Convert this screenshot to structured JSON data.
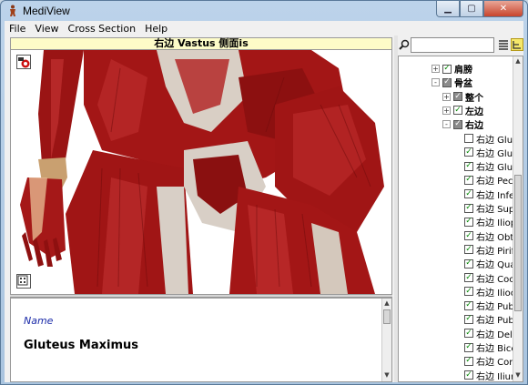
{
  "window": {
    "title": "MediView",
    "app_icon": "anatomy-figure-icon",
    "controls": [
      "minimize",
      "maximize",
      "close"
    ]
  },
  "menu": {
    "items": [
      "File",
      "View",
      "Cross Section",
      "Help"
    ]
  },
  "viewer": {
    "title": "右边 Vastus 侧面is",
    "top_left_icon": "render-mode-icon",
    "bottom_left_icon": "dice-icon",
    "colors": {
      "muscle": "#a01515",
      "muscle_dark": "#6e0b0b",
      "tendon": "#d8cfc6",
      "bone": "#e8d2a8",
      "background": "#ffffff"
    }
  },
  "info": {
    "label": "Name",
    "value": "Gluteus Maximus"
  },
  "search": {
    "placeholder": "",
    "value": ""
  },
  "tree": {
    "nodes": [
      {
        "label": "肩膀",
        "state": "checked",
        "bold": true,
        "expander": "+",
        "level": 0
      },
      {
        "label": "骨盆",
        "state": "grey",
        "bold": true,
        "expander": "-",
        "level": 0
      },
      {
        "label": "整个",
        "state": "grey",
        "bold": true,
        "expander": "+",
        "level": 1
      },
      {
        "label": "左边",
        "state": "checked",
        "bold": true,
        "expander": "+",
        "level": 1
      },
      {
        "label": "右边",
        "state": "grey",
        "bold": true,
        "expander": "-",
        "level": 1
      },
      {
        "label": "右边 Glut",
        "state": "unchecked",
        "bold": false,
        "expander": "",
        "level": 2
      },
      {
        "label": "右边 Glut",
        "state": "checked",
        "bold": false,
        "expander": "",
        "level": 2
      },
      {
        "label": "右边 Glut",
        "state": "checked",
        "bold": false,
        "expander": "",
        "level": 2
      },
      {
        "label": "右边 Pec",
        "state": "checked",
        "bold": false,
        "expander": "",
        "level": 2
      },
      {
        "label": "右边 Infe",
        "state": "checked",
        "bold": false,
        "expander": "",
        "level": 2
      },
      {
        "label": "右边 Sup",
        "state": "checked",
        "bold": false,
        "expander": "",
        "level": 2
      },
      {
        "label": "右边 Iliop",
        "state": "checked",
        "bold": false,
        "expander": "",
        "level": 2
      },
      {
        "label": "右边 Obt",
        "state": "checked",
        "bold": false,
        "expander": "",
        "level": 2
      },
      {
        "label": "右边 Pirif",
        "state": "checked",
        "bold": false,
        "expander": "",
        "level": 2
      },
      {
        "label": "右边 Qua",
        "state": "checked",
        "bold": false,
        "expander": "",
        "level": 2
      },
      {
        "label": "右边 Coc",
        "state": "checked",
        "bold": false,
        "expander": "",
        "level": 2
      },
      {
        "label": "右边 Ilioc",
        "state": "checked",
        "bold": false,
        "expander": "",
        "level": 2
      },
      {
        "label": "右边 Pub",
        "state": "checked",
        "bold": false,
        "expander": "",
        "level": 2
      },
      {
        "label": "右边 Pub",
        "state": "checked",
        "bold": false,
        "expander": "",
        "level": 2
      },
      {
        "label": "右边 Delt",
        "state": "checked",
        "bold": false,
        "expander": "",
        "level": 2
      },
      {
        "label": "右边 Bice",
        "state": "checked",
        "bold": false,
        "expander": "",
        "level": 2
      },
      {
        "label": "右边 Cor",
        "state": "checked",
        "bold": false,
        "expander": "",
        "level": 2
      },
      {
        "label": "右边 Iliur",
        "state": "checked",
        "bold": false,
        "expander": "",
        "level": 2
      }
    ]
  }
}
